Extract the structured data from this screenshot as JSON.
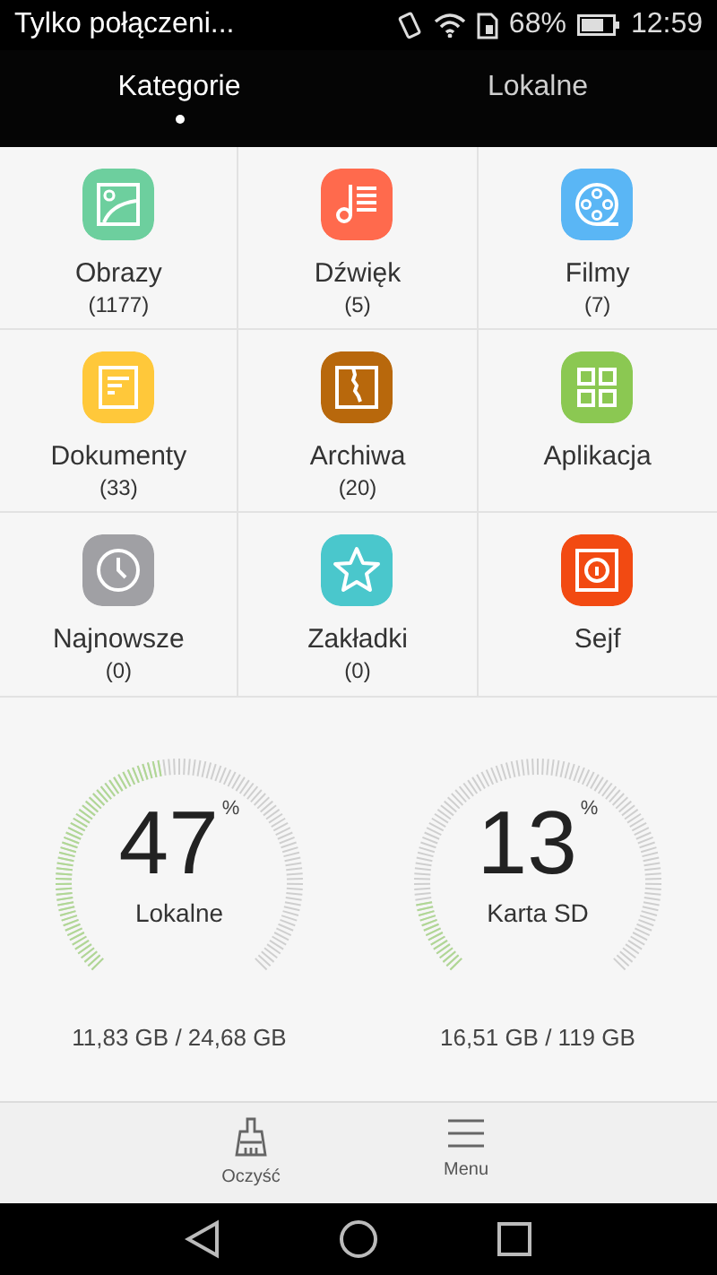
{
  "status_bar": {
    "carrier": "Tylko połączeni...",
    "battery": "68%",
    "time": "12:59"
  },
  "tabs": [
    {
      "label": "Kategorie",
      "selected": true
    },
    {
      "label": "Lokalne",
      "selected": false
    }
  ],
  "categories": [
    {
      "kind": "images",
      "color": "#6dcf9e",
      "label": "Obrazy",
      "count": "(1177)"
    },
    {
      "kind": "music",
      "color": "#ff6a4d",
      "label": "Dźwięk",
      "count": "(5)"
    },
    {
      "kind": "film",
      "color": "#5ab6f5",
      "label": "Filmy",
      "count": "(7)"
    },
    {
      "kind": "document",
      "color": "#ffc83a",
      "label": "Dokumenty",
      "count": "(33)"
    },
    {
      "kind": "archive",
      "color": "#b8680c",
      "label": "Archiwa",
      "count": "(20)"
    },
    {
      "kind": "apps",
      "color": "#8bc852",
      "label": "Aplikacja"
    },
    {
      "kind": "recent",
      "color": "#a0a0a4",
      "label": "Najnowsze",
      "count": "(0)"
    },
    {
      "kind": "bookmark",
      "color": "#4ac7cc",
      "label": "Zakładki",
      "count": "(0)"
    },
    {
      "kind": "safe",
      "color": "#f24a12",
      "label": "Sejf"
    }
  ],
  "storage": [
    {
      "percent": "47",
      "unit": "%",
      "name": "Lokalne",
      "usage": "11,83 GB / 24,68 GB"
    },
    {
      "percent": "13",
      "unit": "%",
      "name": "Karta SD",
      "usage": "16,51 GB / 119 GB"
    }
  ],
  "bottom_bar": [
    {
      "kind": "clean",
      "label": "Oczyść"
    },
    {
      "kind": "menu",
      "label": "Menu"
    }
  ]
}
